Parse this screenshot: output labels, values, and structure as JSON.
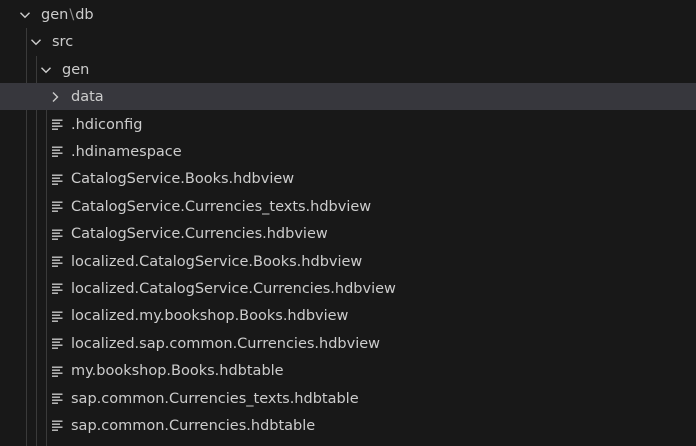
{
  "tree": {
    "root": {
      "segments": [
        "gen",
        "db"
      ],
      "separator": "\\",
      "icon": "chevron-down-icon"
    },
    "src": {
      "label": "src",
      "icon": "chevron-down-icon"
    },
    "gen": {
      "label": "gen",
      "icon": "chevron-down-icon"
    },
    "data": {
      "label": "data",
      "icon": "chevron-right-icon",
      "selected": true
    },
    "files": [
      {
        "label": ".hdiconfig"
      },
      {
        "label": ".hdinamespace"
      },
      {
        "label": "CatalogService.Books.hdbview"
      },
      {
        "label": "CatalogService.Currencies_texts.hdbview"
      },
      {
        "label": "CatalogService.Currencies.hdbview"
      },
      {
        "label": "localized.CatalogService.Books.hdbview"
      },
      {
        "label": "localized.CatalogService.Currencies.hdbview"
      },
      {
        "label": "localized.my.bookshop.Books.hdbview"
      },
      {
        "label": "localized.sap.common.Currencies.hdbview"
      },
      {
        "label": "my.bookshop.Books.hdbtable"
      },
      {
        "label": "sap.common.Currencies_texts.hdbtable"
      },
      {
        "label": "sap.common.Currencies.hdbtable"
      }
    ],
    "file_icon": "text-file-icon"
  },
  "colors": {
    "background": "#181818",
    "text": "#cccccc",
    "selected_row": "#37373d",
    "indent_guide": "#3a3a3a"
  }
}
